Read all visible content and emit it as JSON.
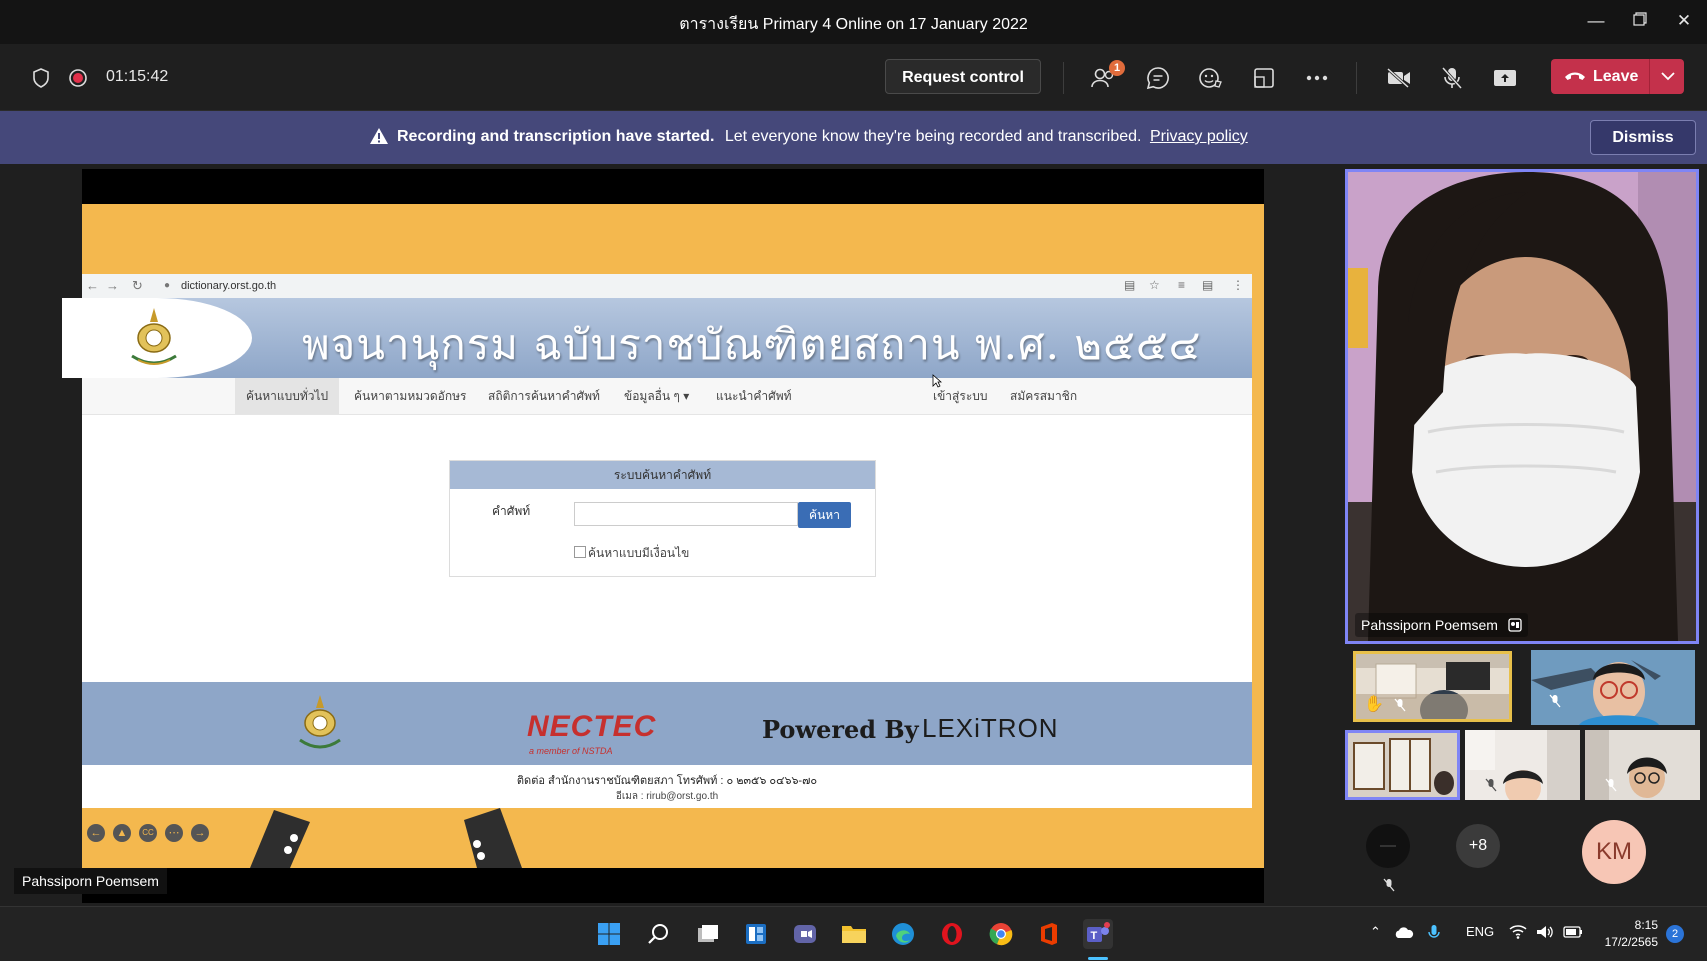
{
  "window": {
    "title": "ตารางเรียน Primary 4 Online on 17 January 2022"
  },
  "toolbar": {
    "timer": "01:15:42",
    "request_control": "Request control",
    "participants_badge": "1",
    "leave": "Leave"
  },
  "banner": {
    "bold": "Recording and transcription have started.",
    "text": "Let everyone know they're being recorded and transcribed.",
    "link": "Privacy policy",
    "dismiss": "Dismiss"
  },
  "shared_screen": {
    "url": "dictionary.orst.go.th",
    "site_title": "พจนานุกรม ฉบับราชบัณฑิตยสถาน พ.ศ. ๒๕๕๔",
    "menu": [
      "ค้นหาแบบทั่วไป",
      "ค้นหาตามหมวดอักษร",
      "สถิติการค้นหาคำศัพท์",
      "ข้อมูลอื่น ๆ ▾",
      "แนะนำคำศัพท์",
      "เข้าสู่ระบบ",
      "สมัครสมาชิก"
    ],
    "search_header": "ระบบค้นหาคำศัพท์",
    "search_label": "คำศัพท์",
    "search_value": "",
    "search_button": "ค้นหา",
    "checkbox_label": "ค้นหาแบบมีเงื่อนไข",
    "footer_brand": "NECTEC",
    "footer_brand_sub": "a member of NSTDA",
    "powered_by": "Powered By",
    "lexitron": "LEXiTRON",
    "contact_line1": "ติดต่อ สำนักงานราชบัณฑิตยสภา โทรศัพท์ : ๐ ๒๓๕๖ ๐๔๖๖-๗๐",
    "contact_line2": "อีเมล : rirub@orst.go.th",
    "presenter": "Pahssiporn Poemsem"
  },
  "participants": {
    "main_name": "Pahssiporn Poemsem",
    "overflow": "+8",
    "initials": "KM"
  },
  "taskbar": {
    "language": "ENG",
    "time": "8:15",
    "date": "17/2/2565",
    "notifications": "2"
  }
}
